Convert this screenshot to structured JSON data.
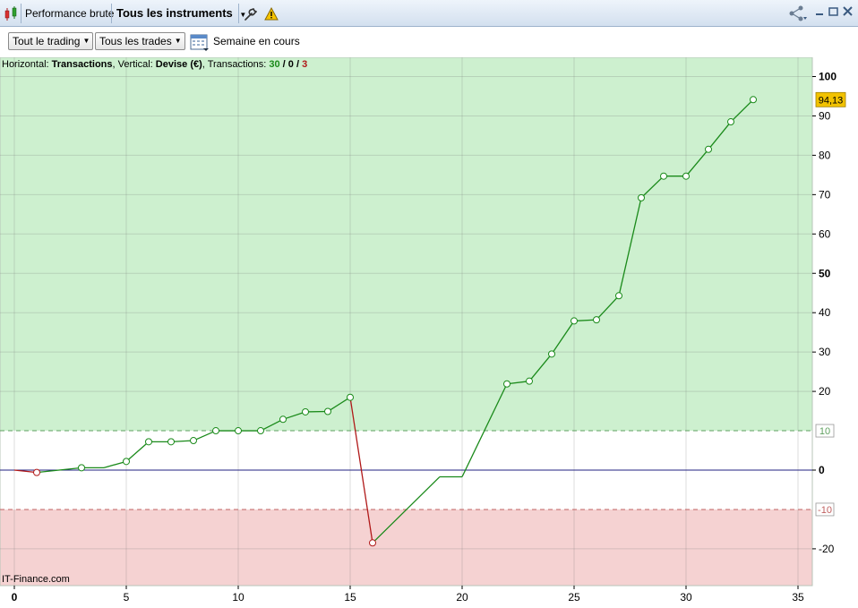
{
  "titlebar": {
    "tab1": "Performance brute",
    "tab2": "Tous les instruments",
    "tab2_arrow": "▼"
  },
  "toolbar": {
    "dropdown1": "Tout le trading",
    "dropdown2": "Tous les trades",
    "period": "Semaine en cours"
  },
  "info": {
    "horizontal_label": "Horizontal: ",
    "horizontal_value": "Transactions",
    "vertical_label": ", Vertical: ",
    "vertical_value": "Devise (€)",
    "transactions_label": ", Transactions: ",
    "count_win": "30",
    "sep1": " / ",
    "count_even": "0",
    "sep2": " / ",
    "count_loss": "3"
  },
  "credit": "IT-Finance.com",
  "colors": {
    "profit_zone": "#cdf0cf",
    "loss_zone": "#f5d2d2",
    "gain_line": "#1a8a1a",
    "loss_line": "#b01818",
    "zero_line": "#202080",
    "last_label_bg": "#f2c200"
  },
  "icons": [
    "candles-icon",
    "wrench-icon",
    "warning-icon",
    "share-icon",
    "calendar-icon",
    "minimize-icon",
    "maximize-icon",
    "close-icon"
  ],
  "chart_data": {
    "type": "line",
    "xlabel": "",
    "ylabel": "",
    "xlim": [
      0,
      35.5
    ],
    "ylim": [
      -29,
      104
    ],
    "x_ticks": [
      0,
      5,
      10,
      15,
      20,
      25,
      30,
      35
    ],
    "y_ticks": [
      100,
      90,
      80,
      70,
      60,
      50,
      40,
      30,
      20,
      0,
      -20
    ],
    "y_ticks_bold": [
      100,
      50,
      0
    ],
    "thresholds": [
      {
        "value": 10,
        "label": "10"
      },
      {
        "value": -10,
        "label": "-10"
      }
    ],
    "last_value_label": "94,13",
    "last_value": 94.13,
    "grid": true,
    "points": [
      {
        "x": 0,
        "y": 0,
        "marker": false
      },
      {
        "x": 1,
        "y": -0.6,
        "marker": true
      },
      {
        "x": 3,
        "y": 0.6,
        "marker": true
      },
      {
        "x": 4,
        "y": 0.6,
        "marker": false
      },
      {
        "x": 5,
        "y": 2.2,
        "marker": true
      },
      {
        "x": 6,
        "y": 7.2,
        "marker": true
      },
      {
        "x": 7,
        "y": 7.2,
        "marker": true
      },
      {
        "x": 8,
        "y": 7.5,
        "marker": true
      },
      {
        "x": 9,
        "y": 10.0,
        "marker": true
      },
      {
        "x": 10,
        "y": 10.0,
        "marker": true
      },
      {
        "x": 11,
        "y": 10.0,
        "marker": true
      },
      {
        "x": 12,
        "y": 12.9,
        "marker": true
      },
      {
        "x": 13,
        "y": 14.8,
        "marker": true
      },
      {
        "x": 14,
        "y": 14.9,
        "marker": true
      },
      {
        "x": 15,
        "y": 18.5,
        "marker": true
      },
      {
        "x": 16,
        "y": -18.5,
        "marker": true
      },
      {
        "x": 19,
        "y": -1.7,
        "marker": false
      },
      {
        "x": 20,
        "y": -1.7,
        "marker": false
      },
      {
        "x": 22,
        "y": 21.9,
        "marker": true
      },
      {
        "x": 23,
        "y": 22.6,
        "marker": true
      },
      {
        "x": 24,
        "y": 29.5,
        "marker": true
      },
      {
        "x": 25,
        "y": 37.9,
        "marker": true
      },
      {
        "x": 26,
        "y": 38.2,
        "marker": true
      },
      {
        "x": 27,
        "y": 44.3,
        "marker": true
      },
      {
        "x": 28,
        "y": 69.2,
        "marker": true
      },
      {
        "x": 29,
        "y": 74.7,
        "marker": true
      },
      {
        "x": 30,
        "y": 74.7,
        "marker": true
      },
      {
        "x": 31,
        "y": 81.5,
        "marker": true
      },
      {
        "x": 32,
        "y": 88.5,
        "marker": true
      },
      {
        "x": 33,
        "y": 94.13,
        "marker": true
      }
    ]
  }
}
